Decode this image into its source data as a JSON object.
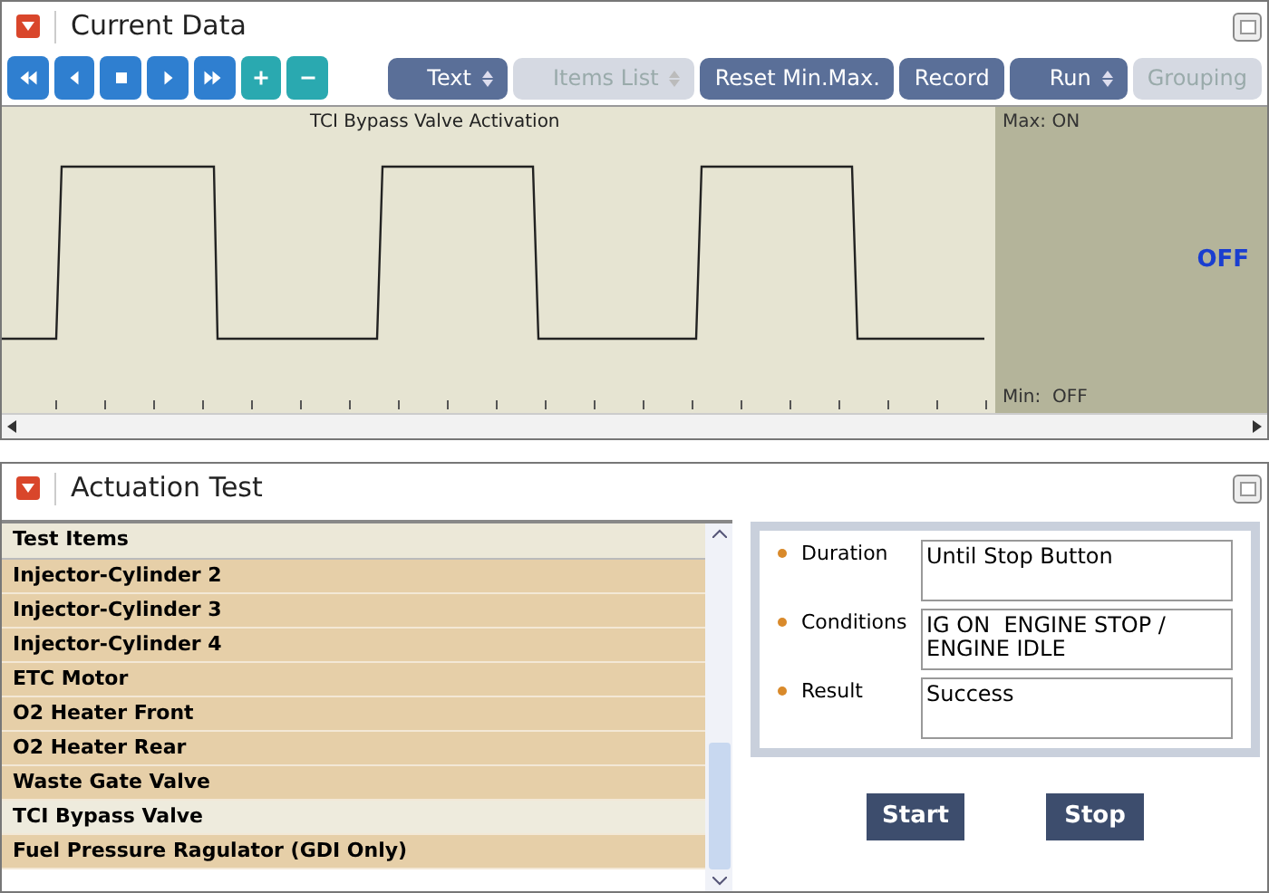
{
  "current_data": {
    "title": "Current Data",
    "toolbar": [
      {
        "kind": "dropdown",
        "label": "Text",
        "disabled": false
      },
      {
        "kind": "dropdown",
        "label": "Items List",
        "disabled": true
      },
      {
        "kind": "button",
        "label": "Reset Min.Max.",
        "disabled": false
      },
      {
        "kind": "button",
        "label": "Record",
        "disabled": false
      },
      {
        "kind": "dropdown",
        "label": "Run",
        "disabled": false
      },
      {
        "kind": "button",
        "label": "Grouping",
        "disabled": true
      }
    ],
    "graph": {
      "title": "TCI Bypass Valve Activation",
      "max": "Max: ON",
      "min": "Min:  OFF",
      "value": "OFF"
    }
  },
  "actuation_test": {
    "title": "Actuation Test",
    "column": "Test Items",
    "items": [
      {
        "label": "Injector-Cylinder 2",
        "selected": false
      },
      {
        "label": "Injector-Cylinder 3",
        "selected": false
      },
      {
        "label": "Injector-Cylinder 4",
        "selected": false
      },
      {
        "label": "ETC Motor",
        "selected": false
      },
      {
        "label": "O2 Heater Front",
        "selected": false
      },
      {
        "label": "O2 Heater Rear",
        "selected": false
      },
      {
        "label": "Waste Gate Valve",
        "selected": false
      },
      {
        "label": "TCI Bypass Valve",
        "selected": true
      },
      {
        "label": "Fuel Pressure Ragulator (GDI Only)",
        "selected": false
      }
    ],
    "details": [
      {
        "label": "Duration",
        "value": "Until Stop Button"
      },
      {
        "label": "Conditions",
        "value": "IG ON  ENGINE STOP / ENGINE IDLE"
      },
      {
        "label": "Result",
        "value": "Success"
      }
    ],
    "buttons": [
      "Start",
      "Stop"
    ]
  }
}
